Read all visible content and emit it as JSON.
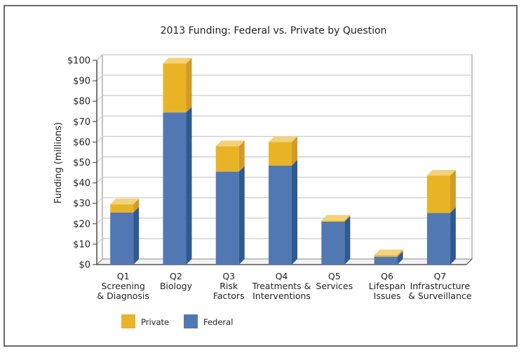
{
  "chart_data": {
    "type": "bar",
    "stacked": true,
    "style": "3d",
    "title": "2013 Funding: Federal vs. Private by Question",
    "xlabel": "",
    "ylabel": "Funding (millions)",
    "ylim": [
      0,
      100
    ],
    "yticks": [
      0,
      10,
      20,
      30,
      40,
      50,
      60,
      70,
      80,
      90,
      100
    ],
    "ytick_labels": [
      "$0",
      "$10",
      "$20",
      "$30",
      "$40",
      "$50",
      "$60",
      "$70",
      "$80",
      "$90",
      "$100"
    ],
    "grid": true,
    "categories": [
      [
        "Q1",
        "Screening",
        "& Diagnosis"
      ],
      [
        "Q2",
        "Biology"
      ],
      [
        "Q3",
        "Risk",
        "Factors"
      ],
      [
        "Q4",
        "Treatments &",
        "Interventions"
      ],
      [
        "Q5",
        "Services"
      ],
      [
        "Q6",
        "Lifespan",
        "Issues"
      ],
      [
        "Q7",
        "Infrastructure",
        "& Surveillance"
      ]
    ],
    "series": [
      {
        "name": "Federal",
        "color": "#5278B3",
        "values": [
          25.5,
          74.5,
          45.5,
          48.5,
          21,
          3.8,
          25.3
        ]
      },
      {
        "name": "Private",
        "color": "#E8B425",
        "values": [
          4,
          24,
          12.5,
          11.5,
          0.5,
          0.8,
          18.3
        ]
      }
    ],
    "legend": {
      "placement": "bottom-left",
      "items": [
        {
          "label": "Private",
          "color": "#E8B425"
        },
        {
          "label": "Federal",
          "color": "#5278B3"
        }
      ]
    }
  }
}
